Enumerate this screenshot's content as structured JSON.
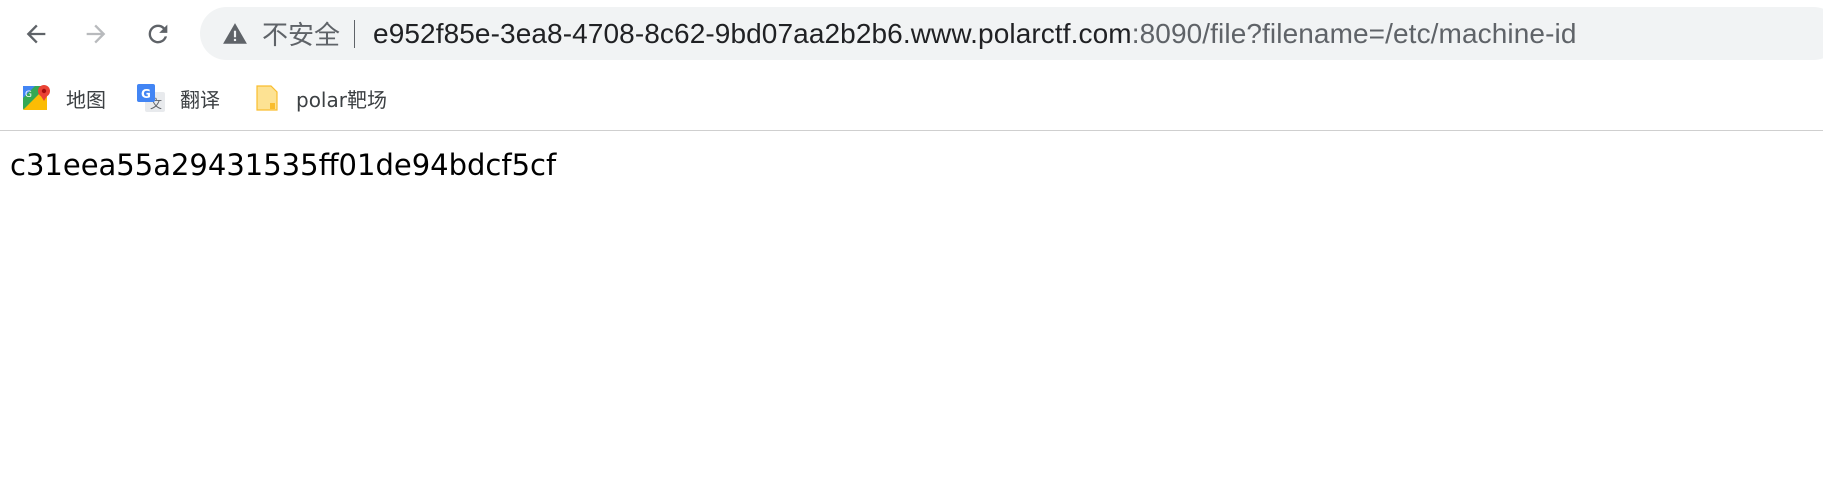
{
  "toolbar": {
    "back_icon": "arrow-left-icon",
    "forward_icon": "arrow-right-icon",
    "reload_icon": "reload-icon"
  },
  "omnibox": {
    "security_icon": "warning-triangle-icon",
    "security_label": "不安全",
    "url_host": "e952f85e-3ea8-4708-8c62-9bd07aa2b2b6.www.polarctf.com",
    "url_rest": ":8090/file?filename=/etc/machine-id"
  },
  "bookmarks": [
    {
      "label": "地图",
      "icon": "google-maps-icon"
    },
    {
      "label": "翻译",
      "icon": "google-translate-icon"
    },
    {
      "label": "polar靶场",
      "icon": "folder-icon"
    }
  ],
  "page": {
    "content_text": "c31eea55a29431535ff01de94bdcf5cf"
  },
  "colors": {
    "omnibox_bg": "#f1f3f4",
    "url_host": "#202124",
    "url_rest": "#5f6368",
    "folder": "#f9d65c"
  }
}
